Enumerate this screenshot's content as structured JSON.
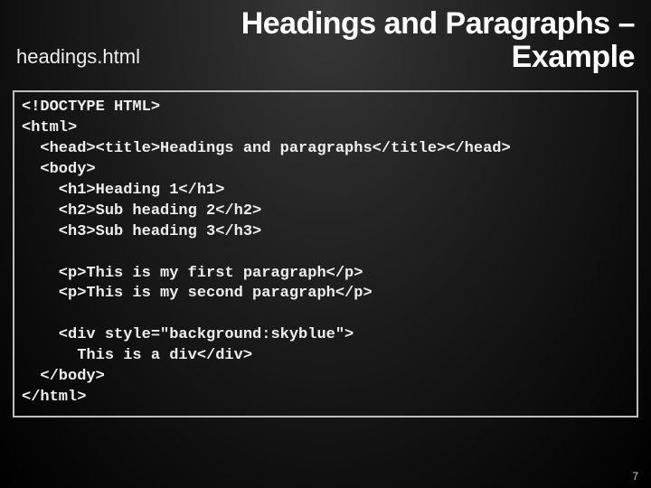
{
  "slide": {
    "title_line1": "Headings and Paragraphs –",
    "title_line2": "Example",
    "subtitle": "headings.html",
    "page_number": "7"
  },
  "code": {
    "l0": "<!DOCTYPE HTML>",
    "l1": "<html>",
    "l2": "  <head><title>Headings and paragraphs</title></head>",
    "l3": "  <body>",
    "l4": "    <h1>Heading 1</h1>",
    "l5": "    <h2>Sub heading 2</h2>",
    "l6": "    <h3>Sub heading 3</h3>",
    "l7": "",
    "l8": "    <p>This is my first paragraph</p>",
    "l9": "    <p>This is my second paragraph</p>",
    "l10": "",
    "l11": "    <div style=\"background:skyblue\">",
    "l12": "      This is a div</div>",
    "l13": "  </body>",
    "l14": "</html>"
  }
}
